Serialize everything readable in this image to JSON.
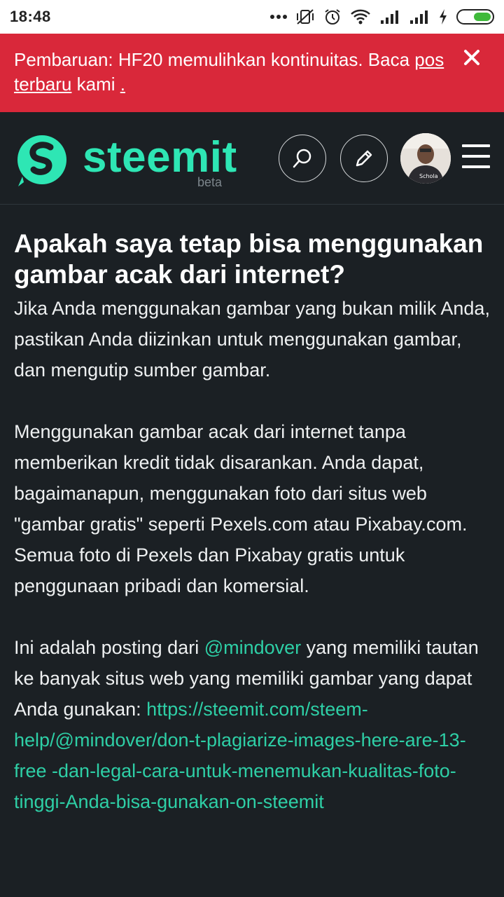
{
  "status_bar": {
    "time": "18:48",
    "icons": [
      "dots-icon",
      "vibrate-off-icon",
      "alarm-icon",
      "wifi-icon",
      "signal-icon",
      "signal-icon",
      "charging-icon",
      "battery-icon"
    ],
    "battery_level": 0.55,
    "battery_color": "#3fb93a"
  },
  "banner": {
    "text_before": "Pembaruan: HF20 memulihkan kontinuitas. Baca ",
    "link_text": "pos terbaru",
    "text_middle": " kami ",
    "link_dot": ".",
    "background": "#d9283a"
  },
  "header": {
    "logo_text": "steemit",
    "logo_badge": "beta",
    "accent": "#2ee6b4"
  },
  "article": {
    "title": "Apakah saya tetap bisa menggunakan gambar acak dari internet?",
    "p1": "Jika Anda menggunakan gambar yang bukan milik Anda, pastikan Anda diizinkan untuk menggunakan gambar, dan mengutip sumber gambar.",
    "p2": "Menggunakan gambar acak dari internet tanpa memberikan kredit tidak disarankan. Anda dapat, bagaimanapun, menggunakan foto dari situs web \"gambar gratis\" seperti Pexels.com atau Pixabay.com. Semua foto di Pexels dan Pixabay gratis untuk penggunaan pribadi dan komersial.",
    "p3_before": "Ini adalah posting dari ",
    "p3_mention": "@mindover",
    "p3_after": " yang memiliki tautan ke banyak situs web yang memiliki gambar yang dapat Anda gunakan: ",
    "p3_link": "https://steemit.com/steem-help/@mindover/don-t-plagiarize-images-here-are-13-free -dan-legal-cara-untuk-menemukan-kualitas-foto-tinggi-Anda-bisa-gunakan-on-steemit",
    "link_color": "#2ecfa6"
  }
}
